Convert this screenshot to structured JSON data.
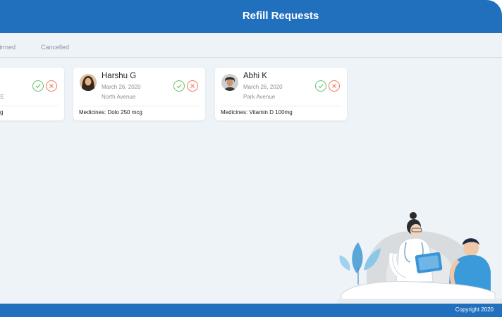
{
  "header": {
    "title": "Refill Requests"
  },
  "tabs": [
    {
      "label": "firmed"
    },
    {
      "label": "Cancelled"
    }
  ],
  "cards": [
    {
      "name": "",
      "date": "",
      "area": "t E",
      "medicines": "g"
    },
    {
      "name": "Harshu G",
      "date": "March 26, 2020",
      "area": "North Avenue",
      "medicines": "Medicines: Dolo 250 mcg"
    },
    {
      "name": "Abhi K",
      "date": "March 26, 2020",
      "area": "Park Avenue",
      "medicines": "Medicines: Vitamin D 100mg"
    }
  ],
  "footer": {
    "copyright": "Copyright 2020"
  },
  "icons": {
    "approve": "check-icon",
    "reject": "close-icon"
  },
  "colors": {
    "primary": "#2170bd",
    "approve": "#67c36b",
    "reject": "#f0785c",
    "background": "#eef3f8"
  }
}
